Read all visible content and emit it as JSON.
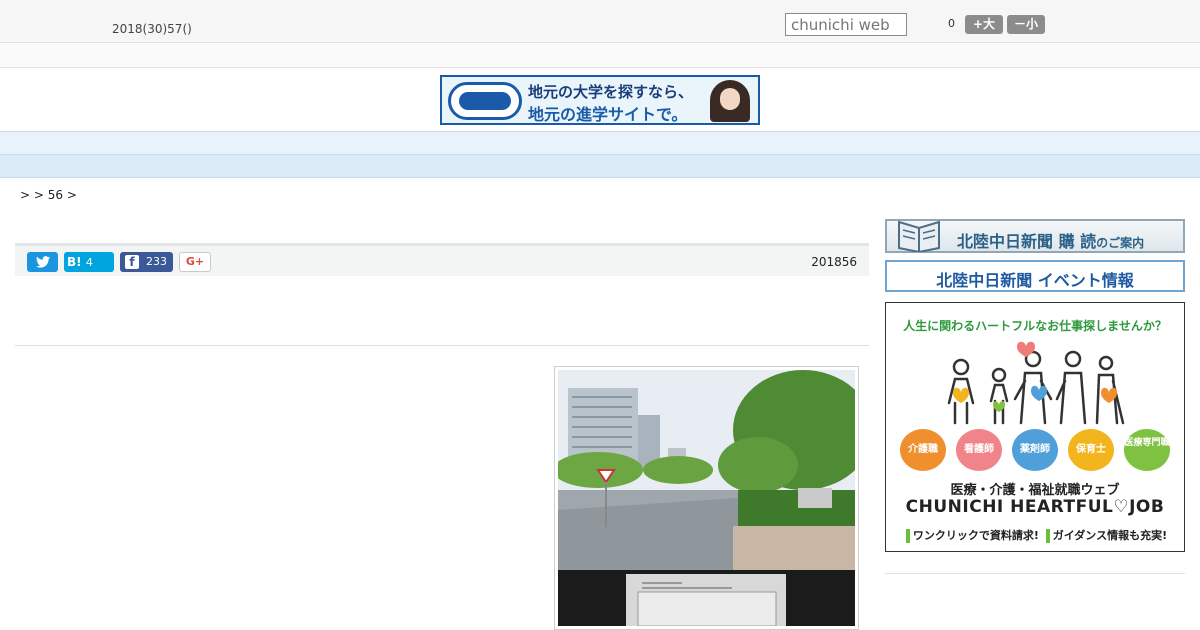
{
  "header": {
    "date": "2018(30)57()",
    "search_placeholder": "chunichi web",
    "zoom_value": "0",
    "font_large_label": "+大",
    "font_small_label": "－小"
  },
  "top_banner": {
    "title": "地元の大学を探すなら、",
    "subtitle": "地元の進学サイトで。"
  },
  "nav": {
    "items": [
      "　　",
      "　　",
      "　　",
      "　　",
      "　　",
      "　　",
      "　　",
      "　　",
      "　　"
    ]
  },
  "breadcrumb": ">  > 56 >",
  "share": {
    "twitter_icon": "twitter-icon",
    "hatena_label": "B!",
    "hatena_count": "4",
    "facebook_label": "f",
    "facebook_count": "233",
    "gplus_label": "G+",
    "pub_date": "201856"
  },
  "sidebar": {
    "subscribe_title": "北陸中日新聞",
    "subscribe_kanji": "購 読",
    "subscribe_suffix": "のご案内",
    "event_title": "北陸中日新聞 イベント情報",
    "job_banner": {
      "headline": "人生に関わるハートフルなお仕事探しませんか？",
      "categories": [
        "介護職",
        "看護師",
        "薬剤師",
        "保育士",
        "医療専門職"
      ],
      "category_colors": [
        "#f08f2e",
        "#f1848a",
        "#4f9fd9",
        "#f2b51d",
        "#7fc241"
      ],
      "line1": "医療・介護・福祉就職ウェブ",
      "line2": "CHUNICHI HEARTFUL♡JOB",
      "footer_left": "ワンクリックで資料請求!",
      "footer_right": "ガイダンス情報も充実!"
    }
  }
}
